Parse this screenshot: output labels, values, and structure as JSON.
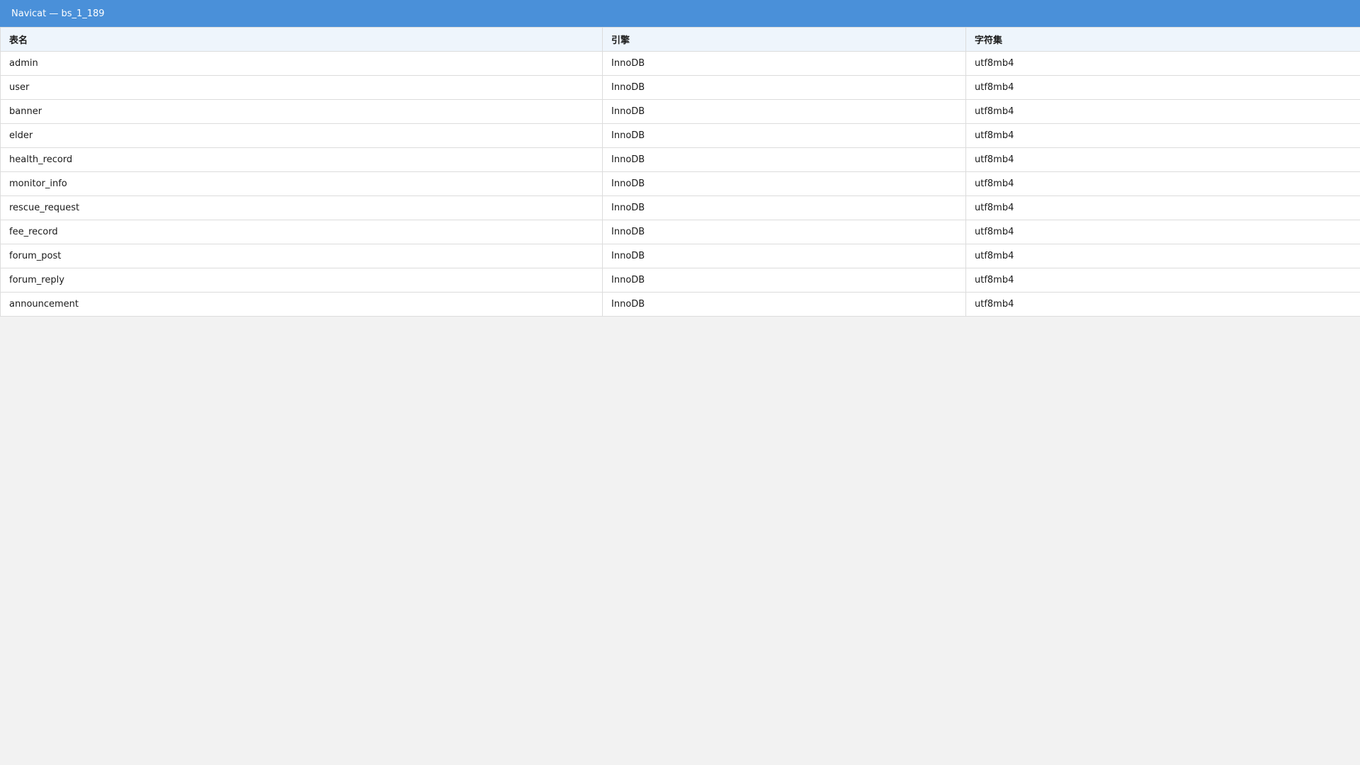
{
  "window": {
    "title": "Navicat — bs_1_189"
  },
  "colors": {
    "titlebar": "#4a90d9",
    "header_bg": "#eef5fc",
    "page_bg": "#f2f2f2"
  },
  "table": {
    "headers": [
      "表名",
      "引擎",
      "字符集"
    ],
    "rows": [
      [
        "admin",
        "InnoDB",
        "utf8mb4"
      ],
      [
        "user",
        "InnoDB",
        "utf8mb4"
      ],
      [
        "banner",
        "InnoDB",
        "utf8mb4"
      ],
      [
        "elder",
        "InnoDB",
        "utf8mb4"
      ],
      [
        "health_record",
        "InnoDB",
        "utf8mb4"
      ],
      [
        "monitor_info",
        "InnoDB",
        "utf8mb4"
      ],
      [
        "rescue_request",
        "InnoDB",
        "utf8mb4"
      ],
      [
        "fee_record",
        "InnoDB",
        "utf8mb4"
      ],
      [
        "forum_post",
        "InnoDB",
        "utf8mb4"
      ],
      [
        "forum_reply",
        "InnoDB",
        "utf8mb4"
      ],
      [
        "announcement",
        "InnoDB",
        "utf8mb4"
      ]
    ]
  }
}
